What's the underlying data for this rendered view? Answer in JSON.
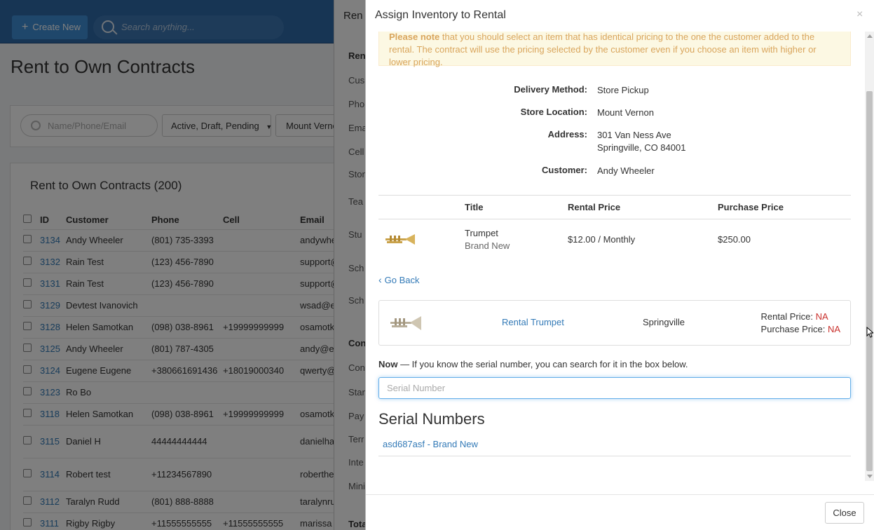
{
  "background": {
    "create_new_label": "Create New",
    "search_placeholder": "Search anything...",
    "page_title": "Rent to Own Contracts",
    "filters": {
      "name_placeholder": "Name/Phone/Email",
      "status_filter": "Active, Draft, Pending",
      "location_filter": "Mount Verno"
    },
    "list": {
      "title": "Rent to Own Contracts (200)",
      "columns": [
        "ID",
        "Customer",
        "Phone",
        "Cell",
        "Email"
      ],
      "rows": [
        {
          "id": "3134",
          "customer": "Andy Wheeler",
          "phone": "(801) 735-3393",
          "cell": "",
          "email": "andywhe"
        },
        {
          "id": "3132",
          "customer": "Rain Test",
          "phone": "(123) 456-7890",
          "cell": "",
          "email": "support@"
        },
        {
          "id": "3131",
          "customer": "Rain Test",
          "phone": "(123) 456-7890",
          "cell": "",
          "email": "support@"
        },
        {
          "id": "3129",
          "customer": "Devtest Ivanovich",
          "phone": "",
          "cell": "",
          "email": "wsad@e"
        },
        {
          "id": "3128",
          "customer": "Helen Samotkan",
          "phone": "(098) 038-8961",
          "cell": "+19999999999",
          "email": "osamotk"
        },
        {
          "id": "3125",
          "customer": "Andy Wheeler",
          "phone": "(801) 787-4305",
          "cell": "",
          "email": "andy@e"
        },
        {
          "id": "3124",
          "customer": "Eugene Eugene",
          "phone": "+380661691436",
          "cell": "+18019000340",
          "email": "qwerty@"
        },
        {
          "id": "3123",
          "customer": "Ro Bo",
          "phone": "",
          "cell": "",
          "email": ""
        },
        {
          "id": "3118",
          "customer": "Helen Samotkan",
          "phone": "(098) 038-8961",
          "cell": "+19999999999",
          "email": "osamotk"
        },
        {
          "id": "3115",
          "customer": "Daniel H",
          "phone": "44444444444",
          "cell": "",
          "email": "danielha"
        },
        {
          "id": "3114",
          "customer": "Robert test",
          "phone": "+11234567890",
          "cell": "",
          "email": "roberthe"
        },
        {
          "id": "3112",
          "customer": "Taralyn Rudd",
          "phone": "(801) 888-8888",
          "cell": "",
          "email": "taralynru"
        },
        {
          "id": "3111",
          "customer": "Rigby Rigby",
          "phone": "+11555555555",
          "cell": "+11555555555",
          "email": "marissa"
        }
      ]
    },
    "side_panel": {
      "title": "Ren",
      "labels": [
        "Ren",
        "Cus",
        "Pho",
        "Ema",
        "Cell",
        "Stor",
        "Tea",
        "Stu",
        "Sch",
        "Sch",
        "Con",
        "Con",
        "Star",
        "Pay",
        "Terr",
        "Inte",
        "Mini",
        "Tota"
      ]
    }
  },
  "modal": {
    "title": "Assign Inventory to Rental",
    "close_x": "×",
    "alert": {
      "bold": "Please note",
      "text": " that you should select an item that has identical pricing to the one the customer added to the rental. The contract will use the pricing selected by the customer even if you choose an item with higher or lower pricing."
    },
    "details": [
      {
        "label": "Delivery Method:",
        "value": "Store Pickup"
      },
      {
        "label": "Store Location:",
        "value": "Mount Vernon"
      },
      {
        "label": "Address:",
        "value": "301 Van Ness Ave",
        "value2": "Springville, CO 84001"
      },
      {
        "label": "Customer:",
        "value": "Andy Wheeler"
      }
    ],
    "item_table": {
      "headers": [
        "Title",
        "Rental Price",
        "Purchase Price"
      ],
      "row": {
        "image": "trumpet-image",
        "title": "Trumpet",
        "condition": "Brand New",
        "rental_price": "$12.00 / Monthly",
        "purchase_price": "$250.00"
      }
    },
    "go_back": "Go Back",
    "inventory": {
      "image": "trumpet-image",
      "name": "Rental Trumpet",
      "location": "Springville",
      "rental_price_label": "Rental Price:",
      "rental_price_value": "NA",
      "purchase_price_label": "Purchase Price:",
      "purchase_price_value": "NA"
    },
    "now_prompt": {
      "bold": "Now",
      "text": " — If you know the serial number, you can search for it in the box below."
    },
    "serial_input": {
      "placeholder": "Serial Number",
      "value": ""
    },
    "serial_heading": "Serial Numbers",
    "serial_results": [
      "asd687asf - Brand New"
    ],
    "close_button": "Close"
  },
  "colors": {
    "link": "#337ab7",
    "alert_bg": "#fcf8e3",
    "alert_text": "#d9a55c",
    "na": "#c9302c",
    "topbar": "#2f6aa8"
  }
}
